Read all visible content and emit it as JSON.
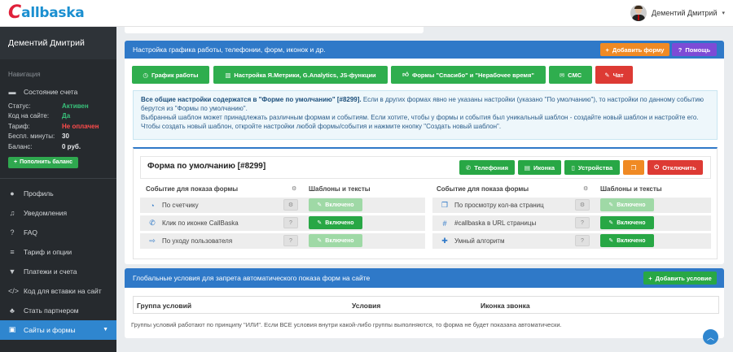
{
  "brand": {
    "logo_c": "C",
    "logo_rest": "allbaska"
  },
  "topbar": {
    "user_name": "Дементий Дмитрий",
    "caret": "▾"
  },
  "sidebar": {
    "user_name": "Дементий Дмитрий",
    "nav_title": "Навигация",
    "account_state_label": "Состояние счета",
    "stats": [
      {
        "key": "Статус:",
        "value": "Активен",
        "color": "#38c07a"
      },
      {
        "key": "Код на сайте:",
        "value": "Да",
        "color": "#38c07a"
      },
      {
        "key": "Тариф:",
        "value": "Не оплачен",
        "color": "#ff4b4b"
      },
      {
        "key": "Беспл. минуты:",
        "value": "30",
        "color": "#e8eaec"
      },
      {
        "key": "Баланс:",
        "value": "0 руб.",
        "color": "#e8eaec"
      }
    ],
    "topup_button": "Пополнить баланс",
    "items": [
      {
        "label": "Профиль",
        "icon": "user-icon"
      },
      {
        "label": "Уведомления",
        "icon": "bell-icon"
      },
      {
        "label": "FAQ",
        "icon": "question-icon"
      },
      {
        "label": "Тариф и опции",
        "icon": "list-icon"
      },
      {
        "label": "Платежи и счета",
        "icon": "cart-icon"
      },
      {
        "label": "Код для вставки на сайт",
        "icon": "code-icon"
      },
      {
        "label": "Стать партнером",
        "icon": "group-icon"
      },
      {
        "label": "Сайты и формы",
        "icon": "sitemap-icon"
      }
    ]
  },
  "settings_panel": {
    "title": "Настройка графика работы, телефонии, форм, иконок и др.",
    "add_form_button": "Добавить форму",
    "help_button": "Помощь",
    "tabs": [
      {
        "label": "График работы",
        "icon": "clock-icon"
      },
      {
        "label": "Настройка Я.Метрики, G.Analytics, JS-функции",
        "icon": "chart-icon"
      },
      {
        "label": "Формы \"Спасибо\" и \"Нерабочее время\"",
        "icon": "thumbs-up-icon"
      },
      {
        "label": "СМС",
        "icon": "envelope-icon"
      },
      {
        "label": "Чат",
        "icon": "chat-icon"
      }
    ],
    "info_bold": "Все общие настройки содержатся в \"Форме по умолчанию\" [#8299].",
    "info_rest": " Если в других формах явно не указаны настройки (указано \"По умолчанию\"), то настройки по данному событию берутся из \"Формы по умолчанию\".",
    "info_line2": "Выбранный шаблон может принадлежать различным формам и событиям. Если хотите, чтобы у формы и события был уникальный шаблон - создайте новый шаблон и настройте его. Чтобы создать новый шаблон, откройте настройки любой формы/события и нажмите кнопку \"Создать новый шаблон\"."
  },
  "form_card": {
    "title": "Форма по умолчанию [#8299]",
    "buttons": {
      "telephony": "Телефония",
      "icon": "Иконка",
      "devices": "Устройства",
      "disable": "Отключить"
    },
    "col_event": "Событие для показа формы",
    "col_templates": "Шаблоны и тексты",
    "enabled_label": "Включено",
    "left_rows": [
      {
        "label": "По счетчику",
        "icon": "counter-icon",
        "active": false
      },
      {
        "label": "Клик по иконке CallBaska",
        "icon": "phone-circle-icon",
        "active": true
      },
      {
        "label": "По уходу пользователя",
        "icon": "exit-icon",
        "active": false
      }
    ],
    "right_rows": [
      {
        "label": "По просмотру кол-ва страниц",
        "icon": "pages-icon",
        "active": false
      },
      {
        "label": "#callbaska в URL страницы",
        "icon": "hash-icon",
        "active": true
      },
      {
        "label": "Умный алгоритм",
        "icon": "puzzle-icon",
        "active": true
      }
    ]
  },
  "global_panel": {
    "title": "Глобальные условия для запрета автоматического показа форм на сайте",
    "add_condition_button": "Добавить условие",
    "columns": [
      "Группа условий",
      "Условия",
      "Иконка звонка"
    ],
    "note": "Группы условий работают по принципу \"ИЛИ\". Если ВСЕ условия внутри какой-либо группы выполняются, то форма не будет показана автоматически."
  }
}
